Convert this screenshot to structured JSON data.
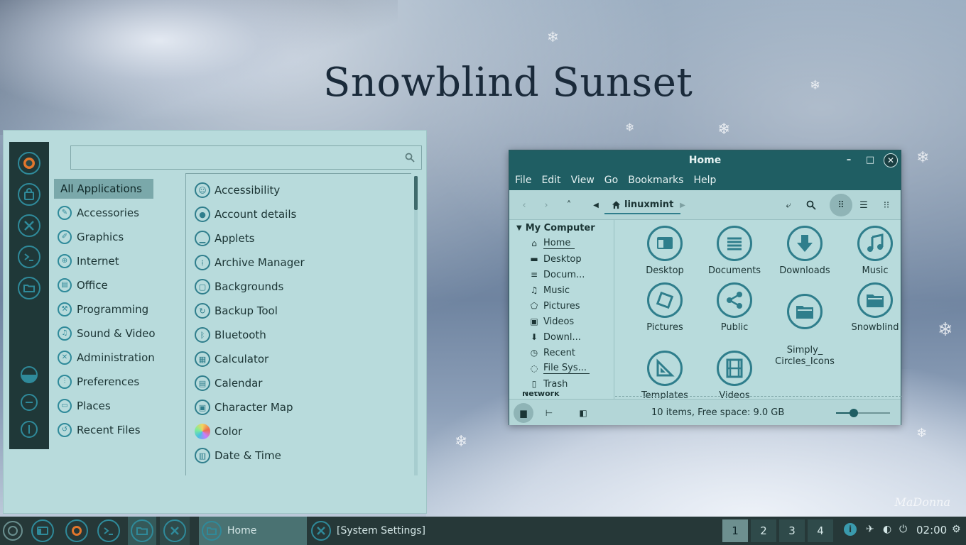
{
  "desktop": {
    "title": "Snowblind Sunset",
    "signature": "MaDonna"
  },
  "menu": {
    "search": {
      "value": "",
      "placeholder": ""
    },
    "sidebar_icons": [
      "firefox-icon",
      "software-manager-icon",
      "system-settings-icon",
      "terminal-icon",
      "files-icon",
      "lock-screen-icon",
      "logout-icon",
      "shutdown-icon"
    ],
    "categories": [
      {
        "label": "All Applications",
        "icon": "all-apps-icon"
      },
      {
        "label": "Accessories",
        "icon": "accessories-icon"
      },
      {
        "label": "Graphics",
        "icon": "graphics-icon"
      },
      {
        "label": "Internet",
        "icon": "internet-icon"
      },
      {
        "label": "Office",
        "icon": "office-icon"
      },
      {
        "label": "Programming",
        "icon": "programming-icon"
      },
      {
        "label": "Sound & Video",
        "icon": "sound-video-icon"
      },
      {
        "label": "Administration",
        "icon": "administration-icon"
      },
      {
        "label": "Preferences",
        "icon": "preferences-icon"
      },
      {
        "label": "Places",
        "icon": "places-icon"
      },
      {
        "label": "Recent Files",
        "icon": "recent-files-icon"
      }
    ],
    "apps": [
      {
        "label": "Accessibility",
        "icon": "accessibility-icon"
      },
      {
        "label": "Account details",
        "icon": "account-icon"
      },
      {
        "label": "Applets",
        "icon": "applets-icon"
      },
      {
        "label": "Archive Manager",
        "icon": "archive-icon"
      },
      {
        "label": "Backgrounds",
        "icon": "backgrounds-icon"
      },
      {
        "label": "Backup Tool",
        "icon": "backup-icon"
      },
      {
        "label": "Bluetooth",
        "icon": "bluetooth-icon"
      },
      {
        "label": "Calculator",
        "icon": "calculator-icon"
      },
      {
        "label": "Calendar",
        "icon": "calendar-icon"
      },
      {
        "label": "Character Map",
        "icon": "character-map-icon"
      },
      {
        "label": "Color",
        "icon": "color-icon"
      },
      {
        "label": "Date & Time",
        "icon": "date-time-icon"
      }
    ]
  },
  "file_manager": {
    "title": "Home",
    "menus": [
      "File",
      "Edit",
      "View",
      "Go",
      "Bookmarks",
      "Help"
    ],
    "path_label": "linuxmint",
    "sidebar_heading": "My Computer",
    "sidebar_items": [
      {
        "label": "Home",
        "icon": "home-icon"
      },
      {
        "label": "Desktop",
        "icon": "desktop-icon"
      },
      {
        "label": "Docum...",
        "icon": "documents-icon"
      },
      {
        "label": "Music",
        "icon": "music-icon"
      },
      {
        "label": "Pictures",
        "icon": "pictures-icon"
      },
      {
        "label": "Videos",
        "icon": "videos-icon"
      },
      {
        "label": "Downl...",
        "icon": "downloads-icon"
      },
      {
        "label": "Recent",
        "icon": "recent-icon"
      },
      {
        "label": "File Sys...",
        "icon": "filesystem-icon"
      },
      {
        "label": "Trash",
        "icon": "trash-icon"
      }
    ],
    "sidebar_cutoff": "Network",
    "files": [
      {
        "label": "Desktop",
        "icon": "desktop-folder-icon"
      },
      {
        "label": "Documents",
        "icon": "documents-folder-icon"
      },
      {
        "label": "Downloads",
        "icon": "downloads-folder-icon"
      },
      {
        "label": "Music",
        "icon": "music-folder-icon"
      },
      {
        "label": "Pictures",
        "icon": "pictures-folder-icon"
      },
      {
        "label": "Public",
        "icon": "public-folder-icon"
      },
      {
        "label": "Simply_\nCircles_Icons",
        "icon": "folder-icon"
      },
      {
        "label": "Snowblind",
        "icon": "folder-icon"
      },
      {
        "label": "Templates",
        "icon": "templates-folder-icon"
      },
      {
        "label": "Videos",
        "icon": "videos-folder-icon"
      }
    ],
    "status": "10 items, Free space: 9.0 GB",
    "zoom": 0.33
  },
  "taskbar": {
    "launchers": [
      "menu-icon",
      "files-icon",
      "firefox-icon",
      "terminal-icon",
      "files-icon",
      "system-settings-icon"
    ],
    "tasks": [
      {
        "label": "Home",
        "icon": "files-icon"
      },
      {
        "label": "[System Settings]",
        "icon": "system-settings-icon"
      }
    ],
    "workspaces": [
      "1",
      "2",
      "3",
      "4"
    ],
    "active_workspace": "1",
    "tray": [
      "info-icon",
      "network-icon",
      "volume-icon",
      "power-icon"
    ],
    "clock": "02:00"
  },
  "colors": {
    "accent": "#2f8a9a",
    "panel": "#263838",
    "menu_bg": "#b8dbdc",
    "titlebar": "#1f5e63"
  }
}
